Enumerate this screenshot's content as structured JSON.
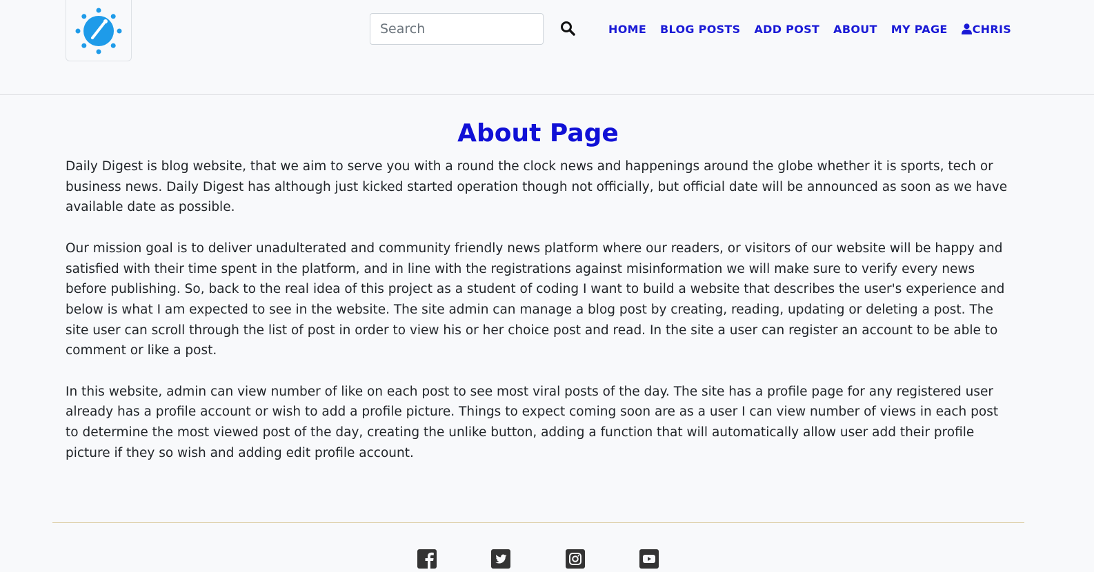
{
  "header": {
    "logo_icon": "compass-sun-icon",
    "search": {
      "placeholder": "Search",
      "value": "",
      "button_icon": "search-icon"
    },
    "nav": {
      "home": "HOME",
      "blog_posts": "BLOG POSTS",
      "add_post": "ADD POST",
      "about": "ABOUT",
      "my_page": "MY PAGE",
      "user": "CHRIS",
      "user_icon": "user-icon"
    }
  },
  "main": {
    "title": "About Page",
    "paragraphs": [
      "Daily Digest is blog website, that we aim to serve you with a round the clock news and happenings around the globe whether it is sports, tech or business news. Daily Digest has although just kicked started operation though not officially, but official date will be announced as soon as we have available date as possible.",
      "Our mission goal is to deliver unadulterated and community friendly news platform where our readers, or visitors of our website will be happy and satisfied with their time spent in the platform, and in line with the registrations against misinformation we will make sure to verify every news before publishing. So, back to the real idea of this project as a student of coding I want to build a website that describes the user's experience and below is what I am expected to see in the website. The site admin can manage a blog post by creating, reading, updating or deleting a post. The site user can scroll through the list of post in order to view his or her choice post and read. In the site a user can register an account to be able to comment or like a post.",
      "In this website, admin can view number of like on each post to see most viral posts of the day. The site has a profile page for any registered user already has a profile account or wish to add a profile picture. Things to expect coming soon are as a user I can view number of views in each post to determine the most viewed post of the day, creating the unlike button, adding a function that will automatically allow user add their profile picture if they so wish and adding edit profile account."
    ]
  },
  "footer": {
    "social_icons": [
      "facebook-icon",
      "twitter-icon",
      "instagram-icon",
      "youtube-icon"
    ]
  },
  "colors": {
    "accent": "#1a1ad6",
    "logo": "#1e9be9",
    "footer_rule": "#d9c89b",
    "background": "#f8f9fb"
  }
}
